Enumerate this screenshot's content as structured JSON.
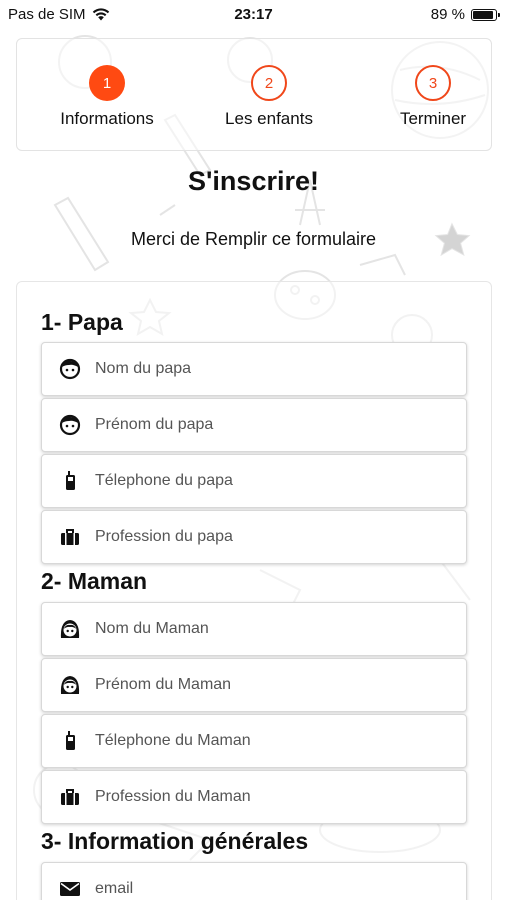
{
  "status": {
    "carrier": "Pas de SIM",
    "time": "23:17",
    "battery_text": "89 %",
    "battery_level": 0.89
  },
  "stepper": {
    "steps": [
      {
        "number": "1",
        "label": "Informations",
        "state": "active"
      },
      {
        "number": "2",
        "label": "Les enfants",
        "state": "inactive"
      },
      {
        "number": "3",
        "label": "Terminer",
        "state": "inactive"
      }
    ]
  },
  "header": {
    "title": "S'inscrire!",
    "subtitle": "Merci de Remplir ce formulaire"
  },
  "sections": {
    "papa": {
      "title": "1- Papa",
      "fields": [
        {
          "placeholder": "Nom du papa",
          "icon": "boy-face-icon"
        },
        {
          "placeholder": "Prénom du papa",
          "icon": "boy-face-icon"
        },
        {
          "placeholder": "Télephone du papa",
          "icon": "phone-icon"
        },
        {
          "placeholder": "Profession du papa",
          "icon": "briefcase-icon"
        }
      ]
    },
    "maman": {
      "title": "2- Maman",
      "fields": [
        {
          "placeholder": "Nom du Maman",
          "icon": "girl-face-icon"
        },
        {
          "placeholder": "Prénom du Maman",
          "icon": "girl-face-icon"
        },
        {
          "placeholder": "Télephone du Maman",
          "icon": "phone-icon"
        },
        {
          "placeholder": "Profession du Maman",
          "icon": "briefcase-icon"
        }
      ]
    },
    "general": {
      "title": "3- Information générales",
      "fields": [
        {
          "placeholder": "email",
          "icon": "envelope-icon"
        }
      ]
    }
  },
  "colors": {
    "accent": "#ff4a12"
  }
}
